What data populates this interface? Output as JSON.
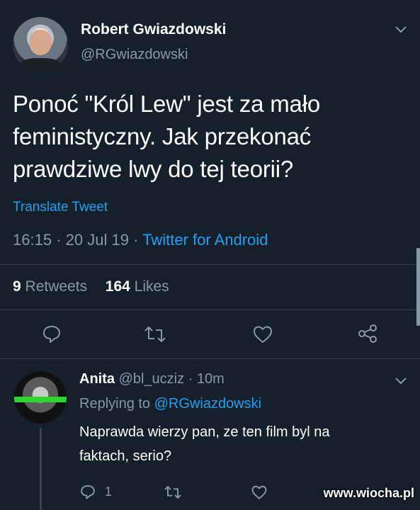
{
  "tweet": {
    "author_name": "Robert Gwiazdowski",
    "author_handle": "@RGwiazdowski",
    "text": "Ponoć \"Król Lew\" jest za mało\nfeministyczny. Jak przekonać\nprawdziwe lwy do tej teorii?",
    "translate_label": "Translate Tweet",
    "time": "16:15",
    "date": "20 Jul 19",
    "separator": "·",
    "source": "Twitter for Android",
    "retweets_count": "9",
    "retweets_label": "Retweets",
    "likes_count": "164",
    "likes_label": "Likes"
  },
  "reply": {
    "author_name": "Anita",
    "author_handle": "@bl_ucziz",
    "age": "· 10m",
    "replying_label": "Replying to",
    "replying_handle": "@RGwiazdowski",
    "text": "Naprawda wierzy pan, ze ten film byl na\nfaktach, serio?",
    "reply_count": "1"
  },
  "watermark": "www.wiocha.pl",
  "icons": {
    "more": "chevron-down-icon",
    "reply": "reply-icon",
    "retweet": "retweet-icon",
    "like": "heart-icon",
    "share": "share-icon"
  },
  "colors": {
    "background": "#15202b",
    "accent": "#1da1f2",
    "muted": "#8899a6",
    "divider": "#38444d"
  }
}
